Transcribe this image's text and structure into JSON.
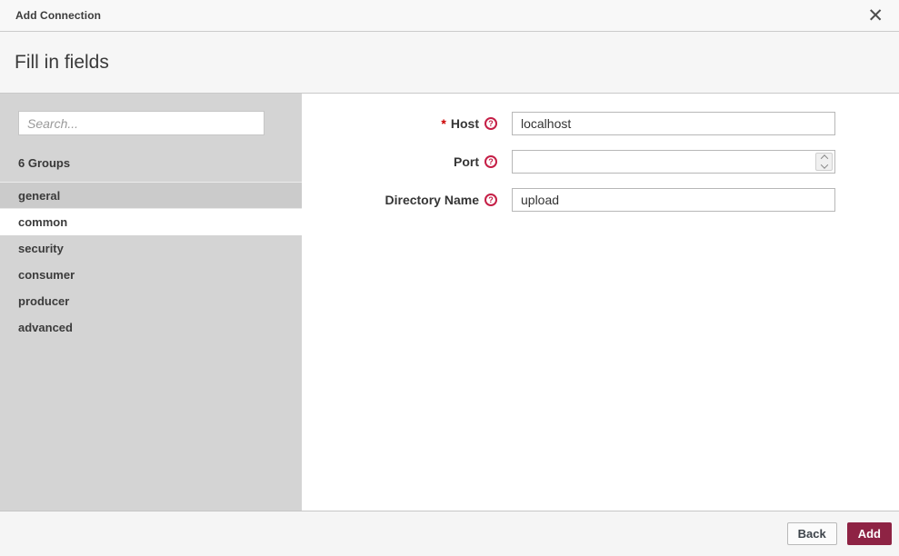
{
  "dialog": {
    "title": "Add Connection",
    "close_glyph": "✕"
  },
  "header": {
    "heading": "Fill in fields"
  },
  "sidebar": {
    "search_placeholder": "Search...",
    "groups_count_label": "6 Groups",
    "items": [
      {
        "label": "general"
      },
      {
        "label": "common"
      },
      {
        "label": "security"
      },
      {
        "label": "consumer"
      },
      {
        "label": "producer"
      },
      {
        "label": "advanced"
      }
    ]
  },
  "form": {
    "required_marker": "*",
    "help_glyph": "?",
    "fields": [
      {
        "label": "Host",
        "value": "localhost"
      },
      {
        "label": "Port",
        "value": ""
      },
      {
        "label": "Directory Name",
        "value": "upload"
      }
    ]
  },
  "footer": {
    "back_label": "Back",
    "add_label": "Add"
  },
  "colors": {
    "accent": "#8e2344",
    "help_icon": "#c51f46",
    "required": "#cc0000",
    "sidebar_bg": "#d4d4d4"
  }
}
